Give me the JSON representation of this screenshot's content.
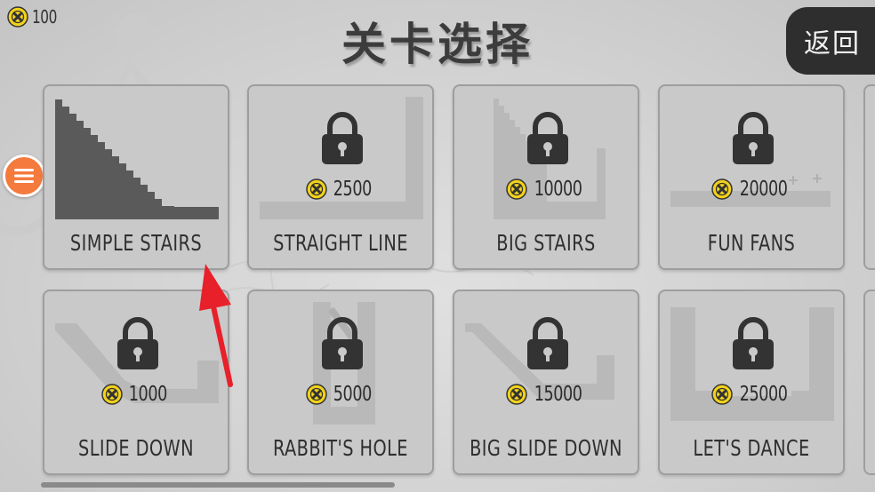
{
  "coins": {
    "value": "100"
  },
  "page_title": "关卡选择",
  "back_label": "返回",
  "levels": [
    {
      "name": "SIMPLE STAIRS",
      "locked": false,
      "price": ""
    },
    {
      "name": "STRAIGHT LINE",
      "locked": true,
      "price": "2500"
    },
    {
      "name": "BIG STAIRS",
      "locked": true,
      "price": "10000"
    },
    {
      "name": "FUN FANS",
      "locked": true,
      "price": "20000"
    },
    {
      "name": "SLIDE DOWN",
      "locked": true,
      "price": "1000"
    },
    {
      "name": "RABBIT'S HOLE",
      "locked": true,
      "price": "5000"
    },
    {
      "name": "BIG SLIDE DOWN",
      "locked": true,
      "price": "15000"
    },
    {
      "name": "LET'S DANCE",
      "locked": true,
      "price": "25000"
    }
  ],
  "icons": {
    "coin": "coin-icon",
    "lock": "lock-icon",
    "menu": "hamburger-menu-icon",
    "back": "back-button"
  },
  "colors": {
    "menu_button": "#f47a3e",
    "back_button": "#2e2e2e",
    "card": "#c9c9c9",
    "coin": "#f2d21b",
    "annotation_arrow": "#e8202a"
  }
}
